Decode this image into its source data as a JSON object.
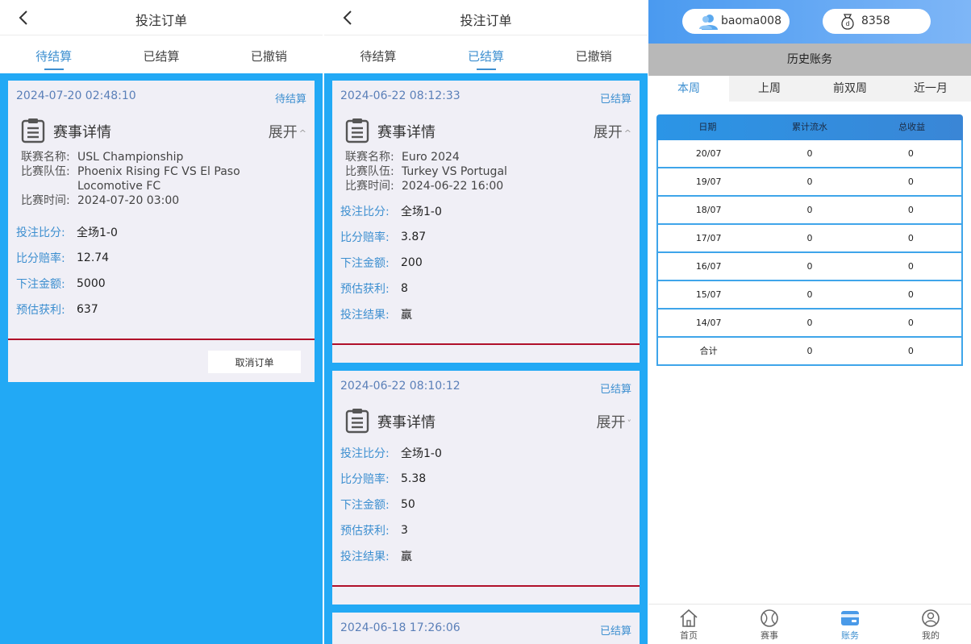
{
  "panel1": {
    "title": "投注订单",
    "tabs": [
      "待结算",
      "已结算",
      "已撤销"
    ],
    "active_tab": 0,
    "card": {
      "time": "2024-07-20 02:48:10",
      "status": "待结算",
      "detail_title": "赛事详情",
      "expand_label": "展开",
      "info": [
        {
          "label": "联赛名称:",
          "value": "USL Championship"
        },
        {
          "label": "比赛队伍:",
          "value": "Phoenix Rising FC VS El Paso Locomotive FC"
        },
        {
          "label": "比赛时间:",
          "value": "2024-07-20 03:00"
        }
      ],
      "fields": [
        {
          "label": "投注比分:",
          "value": "全场1-0"
        },
        {
          "label": "比分赔率:",
          "value": "12.74"
        },
        {
          "label": "下注金额:",
          "value": "5000"
        },
        {
          "label": "预估获利:",
          "value": "637"
        }
      ],
      "cancel_label": "取消订单"
    }
  },
  "panel2": {
    "title": "投注订单",
    "tabs": [
      "待结算",
      "已结算",
      "已撤销"
    ],
    "active_tab": 1,
    "cards": [
      {
        "time": "2024-06-22 08:12:33",
        "status": "已结算",
        "detail_title": "赛事详情",
        "expand_label": "展开",
        "info": [
          {
            "label": "联赛名称:",
            "value": "Euro 2024"
          },
          {
            "label": "比赛队伍:",
            "value": "Turkey VS Portugal"
          },
          {
            "label": "比赛时间:",
            "value": "2024-06-22 16:00"
          }
        ],
        "fields": [
          {
            "label": "投注比分:",
            "value": "全场1-0"
          },
          {
            "label": "比分赔率:",
            "value": "3.87"
          },
          {
            "label": "下注金额:",
            "value": "200"
          },
          {
            "label": "预估获利:",
            "value": "8"
          },
          {
            "label": "投注结果:",
            "value": "赢"
          }
        ]
      },
      {
        "time": "2024-06-22 08:10:12",
        "status": "已结算",
        "detail_title": "赛事详情",
        "expand_label": "展开",
        "fields": [
          {
            "label": "投注比分:",
            "value": "全场1-0"
          },
          {
            "label": "比分赔率:",
            "value": "5.38"
          },
          {
            "label": "下注金额:",
            "value": "50"
          },
          {
            "label": "预估获利:",
            "value": "3"
          },
          {
            "label": "投注结果:",
            "value": "赢"
          }
        ]
      },
      {
        "time": "2024-06-18 17:26:06",
        "status": "已结算"
      }
    ]
  },
  "panel3": {
    "username": "baoma008",
    "balance": "8358",
    "history_title": "历史账务",
    "ranges": [
      "本周",
      "上周",
      "前双周",
      "近一月"
    ],
    "active_range": 0,
    "table": {
      "headers": [
        "日期",
        "累计流水",
        "总收益"
      ],
      "rows": [
        [
          "20/07",
          "0",
          "0"
        ],
        [
          "19/07",
          "0",
          "0"
        ],
        [
          "18/07",
          "0",
          "0"
        ],
        [
          "17/07",
          "0",
          "0"
        ],
        [
          "16/07",
          "0",
          "0"
        ],
        [
          "15/07",
          "0",
          "0"
        ],
        [
          "14/07",
          "0",
          "0"
        ],
        [
          "合计",
          "0",
          "0"
        ]
      ]
    },
    "nav": [
      {
        "label": "首页",
        "icon": "home-icon"
      },
      {
        "label": "赛事",
        "icon": "ball-icon"
      },
      {
        "label": "账务",
        "icon": "wallet-icon"
      },
      {
        "label": "我的",
        "icon": "user-icon"
      }
    ],
    "active_nav": 2,
    "accent": "#3d8fd0"
  }
}
